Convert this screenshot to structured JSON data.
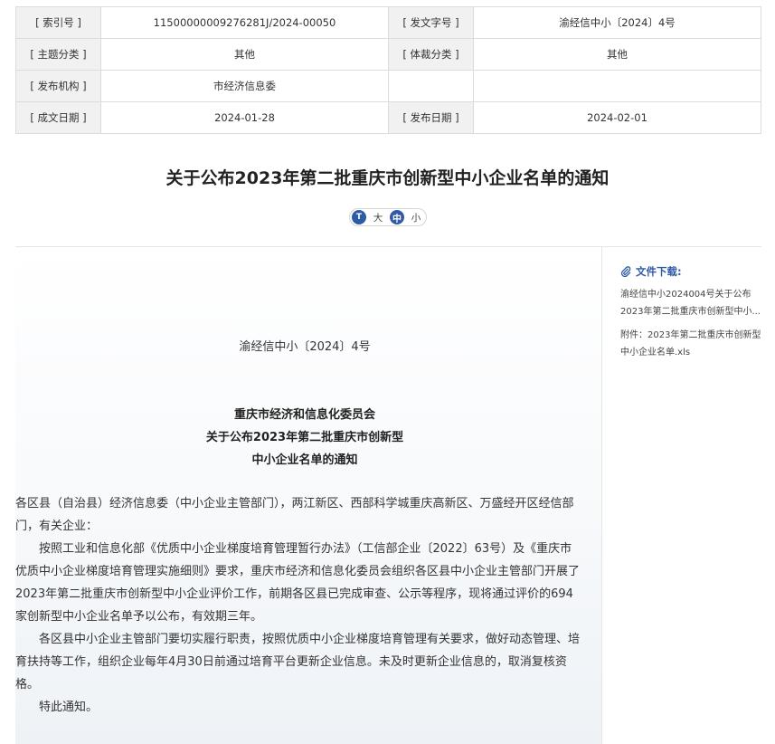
{
  "meta": {
    "rows": [
      {
        "k1": "[ 索引号 ]",
        "v1": "11500000009276281J/2024-00050",
        "k2": "[ 发文字号 ]",
        "v2": "渝经信中小〔2024〕4号"
      },
      {
        "k1": "[ 主题分类 ]",
        "v1": "其他",
        "k2": "[ 体裁分类 ]",
        "v2": "其他"
      },
      {
        "k1": "[ 发布机构 ]",
        "v1": "市经济信息委",
        "k2": "",
        "v2": ""
      },
      {
        "k1": "[ 成文日期 ]",
        "v1": "2024-01-28",
        "k2": "[ 发布日期 ]",
        "v2": "2024-02-01"
      }
    ]
  },
  "title": "关于公布2023年第二批重庆市创新型中小企业名单的通知",
  "font_size_control": {
    "icon_label": "T",
    "large": "大",
    "medium": "中",
    "small": "小"
  },
  "article": {
    "doc_number": "渝经信中小〔2024〕4号",
    "heading_lines": [
      "重庆市经济和信息化委员会",
      "关于公布2023年第二批重庆市创新型",
      "中小企业名单的通知"
    ],
    "salutation": "各区县（自治县）经济信息委（中小企业主管部门），两江新区、西部科学城重庆高新区、万盛经开区经信部门，有关企业：",
    "para1": "按照工业和信息化部《优质中小企业梯度培育管理暂行办法》（工信部企业〔2022〕63号）及《重庆市优质中小企业梯度培育管理实施细则》要求，重庆市经济和信息化委员会组织各区县中小企业主管部门开展了2023年第二批重庆市创新型中小企业评价工作，前期各区县已完成审查、公示等程序，现将通过评价的694家创新型中小企业名单予以公布，有效期三年。",
    "para2": "各区县中小企业主管部门要切实履行职责，按照优质中小企业梯度培育管理有关要求，做好动态管理、培育扶持等工作，组织企业每年4月30日前通过培育平台更新企业信息。未及时更新企业信息的，取消复核资格。",
    "para3": "特此通知。"
  },
  "downloads": {
    "title": "文件下载:",
    "items": [
      {
        "line1": "渝经信中小2024004号关于公布",
        "line2": "2023年第二批重庆市创新型中小..."
      },
      {
        "line1": "附件：2023年第二批重庆市创新型",
        "line2": "中小企业名单.xls"
      }
    ]
  },
  "colors": {
    "accent": "#2e5aa6",
    "label_bg": "#f1f1f1",
    "border": "#dcdcdc"
  }
}
